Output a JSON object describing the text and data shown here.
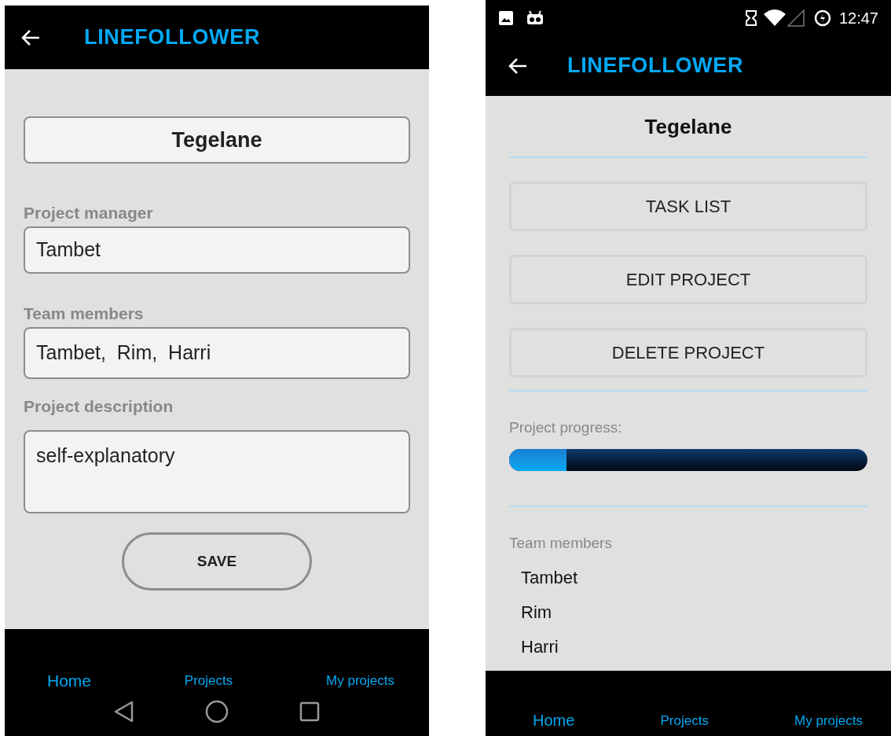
{
  "edit_screen": {
    "app_bar": {
      "title": "LINEFOLLOWER"
    },
    "project_name": "Tegelane",
    "fields": [
      {
        "kind": "line",
        "label": "Project manager",
        "value": "Tambet"
      },
      {
        "kind": "line",
        "label": "Team members",
        "value": "Tambet,  Rim,  Harri"
      },
      {
        "kind": "multiline",
        "label": "Project description",
        "value": "self-explanatory"
      }
    ],
    "save_button": "SAVE",
    "bottom_nav": [
      "Home",
      "Projects",
      "My projects"
    ]
  },
  "detail_screen": {
    "status_bar": {
      "time": "12:47"
    },
    "app_bar": {
      "title": "LINEFOLLOWER"
    },
    "project_name": "Tegelane",
    "actions": [
      "TASK LIST",
      "EDIT PROJECT",
      "DELETE PROJECT"
    ],
    "progress": {
      "label": "Project progress:",
      "level": 0.16
    },
    "team": {
      "heading": "Team members",
      "members": [
        "Tambet",
        "Rim",
        "Harri"
      ]
    },
    "bottom_nav": [
      "Home",
      "Projects",
      "My projects"
    ]
  }
}
